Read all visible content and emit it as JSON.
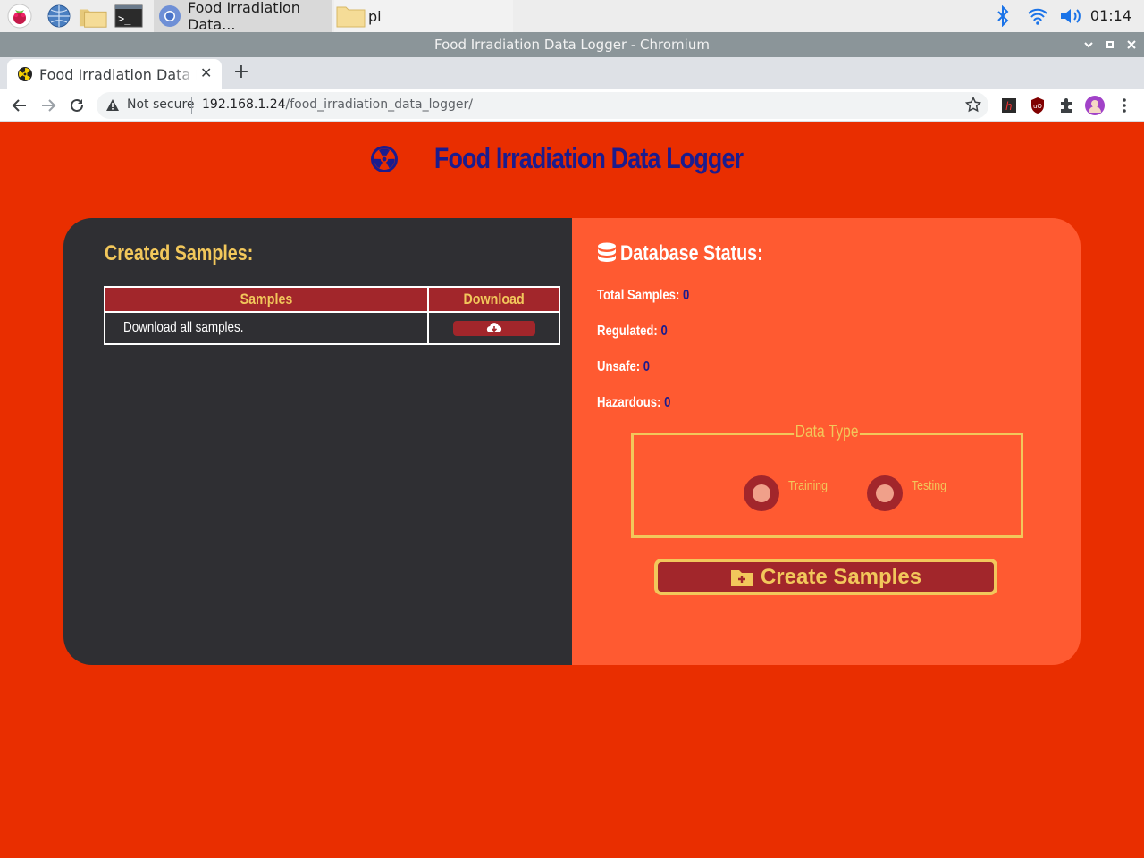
{
  "taskbar": {
    "tasks": [
      {
        "label": "Food Irradiation Data..."
      },
      {
        "label": "pi"
      }
    ],
    "clock": "01:14"
  },
  "window": {
    "title": "Food Irradiation Data Logger - Chromium"
  },
  "browser": {
    "tab_title": "Food Irradiation Data Logger",
    "security_label": "Not secure",
    "url_host": "192.168.1.24",
    "url_path": "/food_irradiation_data_logger/"
  },
  "page": {
    "title": "Food Irradiation Data Logger",
    "created_heading": "Created Samples:",
    "table": {
      "headers": [
        "Samples",
        "Download"
      ],
      "rows": [
        {
          "description": "Download all samples."
        }
      ]
    },
    "db_status": {
      "heading": "Database Status:",
      "stats": [
        {
          "label": "Total Samples:",
          "value": "0"
        },
        {
          "label": "Regulated:",
          "value": "0"
        },
        {
          "label": "Unsafe:",
          "value": "0"
        },
        {
          "label": "Hazardous:",
          "value": "0"
        }
      ]
    },
    "data_type": {
      "legend": "Data Type",
      "options": [
        "Training",
        "Testing"
      ]
    },
    "create_button": "Create Samples"
  },
  "colors": {
    "page_bg": "#e92e00",
    "left_panel": "#2f2f33",
    "right_panel": "#ff5a31",
    "accent_red": "#a2262b",
    "accent_yellow": "#f2c75b",
    "title_blue": "#1b1c8e"
  },
  "icons": [
    "raspberry-menu-icon",
    "web-browser-icon",
    "file-manager-icon",
    "terminal-icon",
    "chromium-icon",
    "folder-icon",
    "bluetooth-icon",
    "wifi-icon",
    "volume-icon",
    "radiation-icon",
    "cloud-download-icon",
    "database-icon",
    "folder-plus-icon"
  ]
}
